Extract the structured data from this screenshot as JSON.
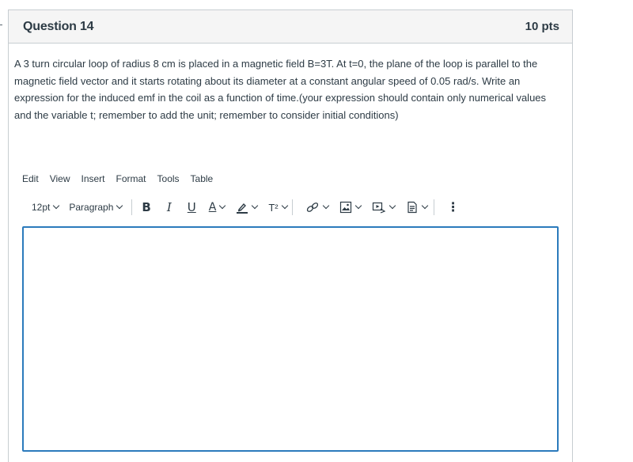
{
  "question": {
    "title": "Question 14",
    "points": "10 pts",
    "text": "A 3 turn circular loop of radius 8 cm is placed in a magnetic field B=3T. At t=0, the plane of the loop is parallel to the magnetic field vector and it starts rotating about its diameter at a constant angular speed of 0.05 rad/s. Write an expression for the induced emf in the coil as a function of time.(your expression should contain only numerical values and the variable t; remember to add the unit; remember to consider initial conditions)"
  },
  "editor": {
    "menu": [
      "Edit",
      "View",
      "Insert",
      "Format",
      "Tools",
      "Table"
    ],
    "font_size": "12pt",
    "block_format": "Paragraph",
    "bold": "B",
    "italic": "I",
    "underline": "U",
    "text_color": "A",
    "superscript": "T²",
    "more": "⋮",
    "content": "",
    "icons": [
      "bold-icon",
      "italic-icon",
      "underline-icon",
      "text-color-icon",
      "highlight-icon",
      "superscript-icon",
      "link-icon",
      "image-icon",
      "media-icon",
      "document-icon",
      "more-icon"
    ],
    "accent_color": "#2b7abc"
  }
}
